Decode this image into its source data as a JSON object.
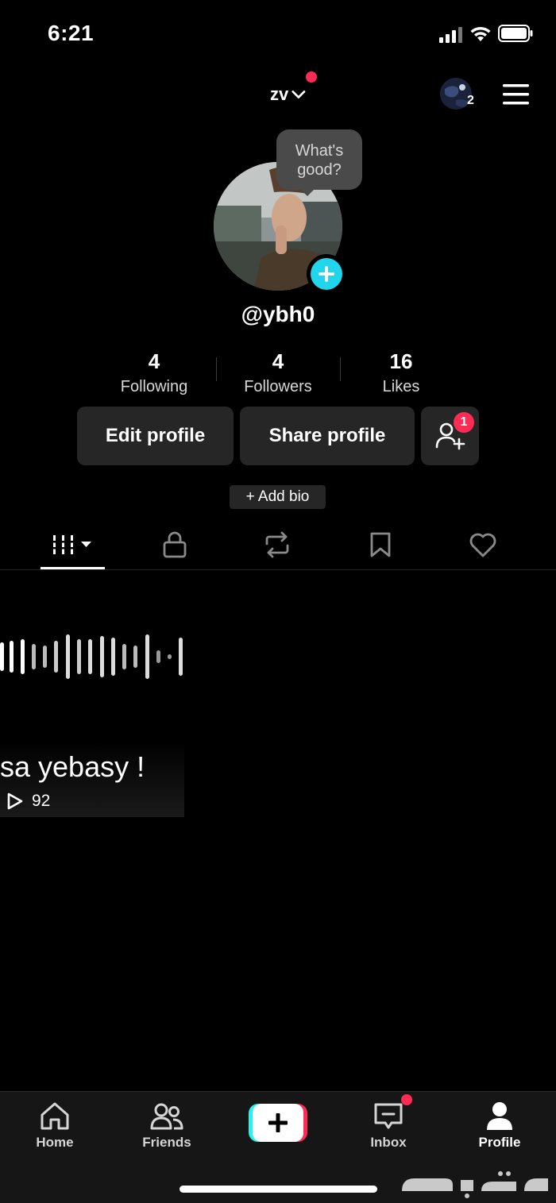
{
  "status_bar": {
    "time": "6:21"
  },
  "top_nav": {
    "account_name": "zv",
    "account_switch_count": "2"
  },
  "profile": {
    "note_bubble": "What's good?",
    "username": "@ybh0",
    "stats": [
      {
        "value": "4",
        "label": "Following"
      },
      {
        "value": "4",
        "label": "Followers"
      },
      {
        "value": "16",
        "label": "Likes"
      }
    ],
    "edit_label": "Edit profile",
    "share_label": "Share profile",
    "add_friends_badge": "1",
    "add_bio_label": "+ Add bio"
  },
  "tabs": [
    {
      "icon": "videos-grid-icon",
      "active": true
    },
    {
      "icon": "lock-icon",
      "active": false
    },
    {
      "icon": "repost-icon",
      "active": false
    },
    {
      "icon": "bookmark-icon",
      "active": false
    },
    {
      "icon": "heart-icon",
      "active": false
    }
  ],
  "videos": [
    {
      "caption": "sa yebasy !",
      "views": "92"
    }
  ],
  "bottom_nav": {
    "home": "Home",
    "friends": "Friends",
    "inbox": "Inbox",
    "profile": "Profile"
  },
  "colors": {
    "accent_red": "#fe2c55",
    "accent_cyan": "#20d5ec",
    "button_bg": "#262626"
  }
}
